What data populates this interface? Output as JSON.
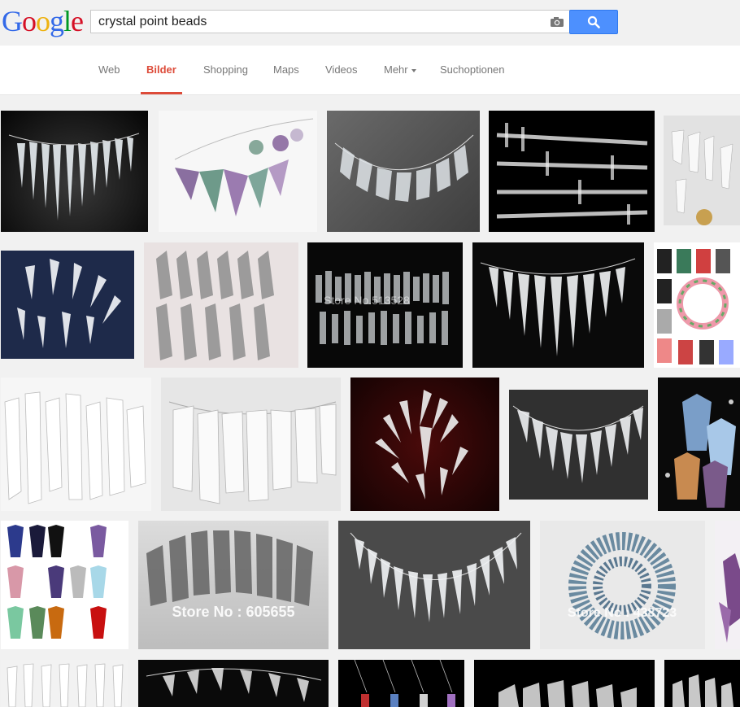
{
  "logo": {
    "letters": [
      "G",
      "o",
      "o",
      "g",
      "l",
      "e"
    ],
    "colors": [
      "#3369e8",
      "#d50f25",
      "#eeb211",
      "#3369e8",
      "#009925",
      "#d50f25"
    ]
  },
  "search": {
    "query": "crystal point beads"
  },
  "nav": {
    "items": [
      "Web",
      "Bilder",
      "Shopping",
      "Maps",
      "Videos",
      "Mehr",
      "Suchoptionen"
    ],
    "active": "Bilder"
  },
  "watermarks": {
    "r4_2": "Store No : 605655",
    "r4_4": "Store No : 438723",
    "r2_3": "Store No.513528"
  },
  "colors": {
    "accent": "#dd4b39",
    "button": "#4d90fe"
  }
}
